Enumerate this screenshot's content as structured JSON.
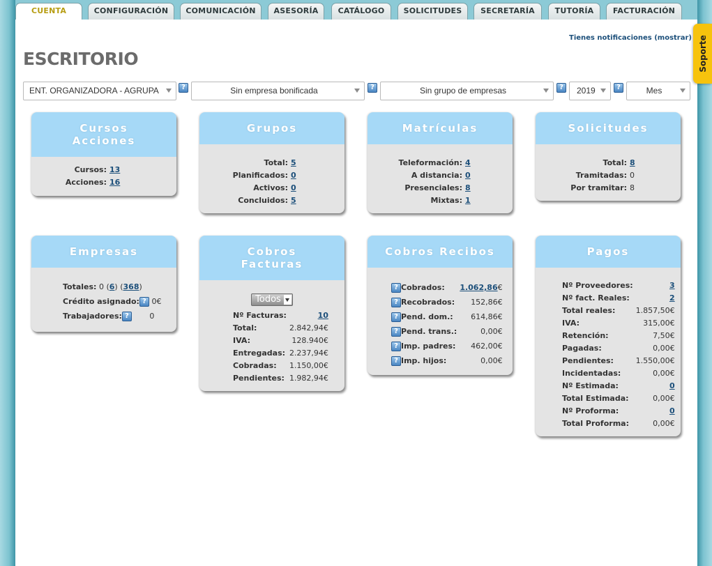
{
  "tabs": [
    {
      "label": "CUENTA",
      "active": true
    },
    {
      "label": "CONFIGURACIÓN"
    },
    {
      "label": "COMUNICACIÓN"
    },
    {
      "label": "ASESORÍA"
    },
    {
      "label": "CATÁLOGO"
    },
    {
      "label": "SOLICITUDES"
    },
    {
      "label": "SECRETARÍA"
    },
    {
      "label": "TUTORÍA"
    },
    {
      "label": "FACTURACIÓN"
    }
  ],
  "header": {
    "title": "ESCRITORIO",
    "notif_text": "Tienes notificaciones",
    "notif_link": "(mostrar)",
    "support_label": "Soporte"
  },
  "filters": {
    "entity": "ENT. ORGANIZADORA - AGRUPAC...",
    "company": "Sin empresa bonificada",
    "group": "Sin grupo de empresas",
    "year": "2019",
    "period": "Mes"
  },
  "help_symbol": "?",
  "cards": {
    "cursos": {
      "title_l1": "Cursos",
      "title_l2": "Acciones",
      "rows": [
        {
          "label": "Cursos:",
          "value": "13"
        },
        {
          "label": "Acciones:",
          "value": "16"
        }
      ]
    },
    "grupos": {
      "title": "Grupos",
      "rows": [
        {
          "label": "Total:",
          "value": "5"
        },
        {
          "label": "Planificados:",
          "value": "0"
        },
        {
          "label": "Activos:",
          "value": "0"
        },
        {
          "label": "Concluidos:",
          "value": "5"
        }
      ]
    },
    "matriculas": {
      "title": "Matrículas",
      "rows": [
        {
          "label": "Teleformación:",
          "value": "4"
        },
        {
          "label": "A distancia:",
          "value": "0"
        },
        {
          "label": "Presenciales:",
          "value": "8"
        },
        {
          "label": "Mixtas:",
          "value": "1"
        }
      ]
    },
    "solicitudes": {
      "title": "Solicitudes",
      "rows": [
        {
          "label": "Total:",
          "value": "8"
        },
        {
          "label": "Tramitadas:",
          "value": "0"
        },
        {
          "label": "Por tramitar:",
          "value": "8"
        }
      ]
    },
    "empresas": {
      "title": "Empresas",
      "totales_label": "Totales:",
      "totales_v1": "0",
      "totales_v2": "6",
      "totales_v3": "368",
      "credito_label": "Crédito asignado:",
      "credito_value": "0€",
      "trabajadores_label": "Trabajadores:",
      "trabajadores_value": "0"
    },
    "cobros_facturas": {
      "title_l1": "Cobros",
      "title_l2": "Facturas",
      "filter": "Todos",
      "rows": [
        {
          "label": "Nº Facturas:",
          "value": "10"
        },
        {
          "label": "Total:",
          "value": "2.842,94€"
        },
        {
          "label": "IVA:",
          "value": "128.940€"
        },
        {
          "label": "Entregadas:",
          "value": "2.237,94€"
        },
        {
          "label": "Cobradas:",
          "value": "1.150,00€"
        },
        {
          "label": "Pendientes:",
          "value": "1.982,94€"
        }
      ]
    },
    "cobros_recibos": {
      "title": "Cobros Recibos",
      "rows": [
        {
          "label": "Cobrados:",
          "value": "1.062,86",
          "suffix": "€"
        },
        {
          "label": "Recobrados:",
          "value": "152,86€"
        },
        {
          "label": "Pend. dom.:",
          "value": "614,86€"
        },
        {
          "label": "Pend. trans.:",
          "value": "0,00€"
        },
        {
          "label": "Imp. padres:",
          "value": "462,00€"
        },
        {
          "label": "Imp. hijos:",
          "value": "0,00€"
        }
      ]
    },
    "pagos": {
      "title": "Pagos",
      "rows": [
        {
          "label": "Nº Proveedores:",
          "value": "3"
        },
        {
          "label": "Nº fact. Reales:",
          "value": "2"
        },
        {
          "label": "Total reales:",
          "value": "1.857,50€"
        },
        {
          "label": "IVA:",
          "value": "315,00€"
        },
        {
          "label": "Retención:",
          "value": "7,50€"
        },
        {
          "label": "Pagadas:",
          "value": "0,00€"
        },
        {
          "label": "Pendientes:",
          "value": "1.550,00€"
        },
        {
          "label": "Incidentadas:",
          "value": "0,00€"
        },
        {
          "label": "Nº Estimada:",
          "value": "0"
        },
        {
          "label": "Total Estimada:",
          "value": "0,00€"
        },
        {
          "label": "Nº Proforma:",
          "value": "0"
        },
        {
          "label": "Total Proforma:",
          "value": "0,00€"
        }
      ]
    }
  },
  "colors": {
    "card_header": "#a6d9f7",
    "card_body": "#e4e4e4",
    "link": "#1c4f7a",
    "active_tab_text": "#b79d12",
    "support_tab": "#f7c30d",
    "frame": "#8ccad6"
  }
}
